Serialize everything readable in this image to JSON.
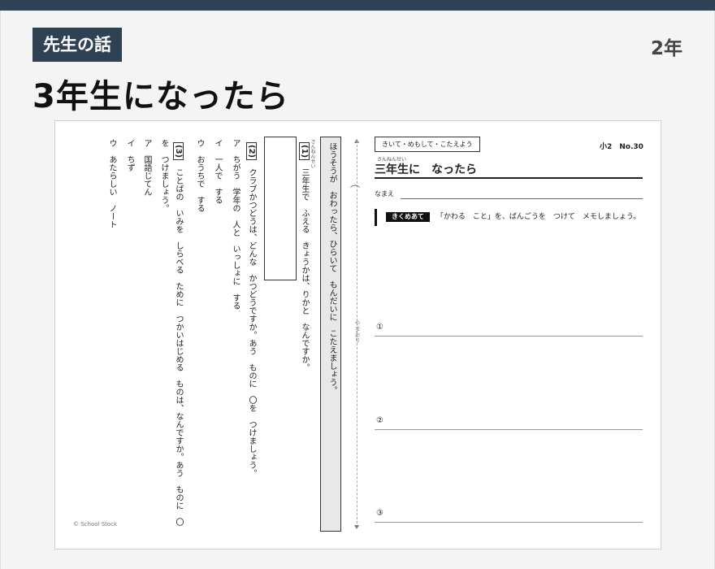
{
  "header": {
    "badge": "先生の話",
    "grade": "2年",
    "title": "3年生になったら"
  },
  "worksheet": {
    "copyright": "© School Stock",
    "fold_label": "やまおり",
    "fold_icon": "⌒",
    "instruction": "ほうそうが　おわったら、ひらいて　もんだいに　こたえましょう。",
    "q1": {
      "number": "(1)",
      "ruby": "さんねんせい",
      "text": "三年生で　ふえる　きょうかは、りかと　なんですか。"
    },
    "q2": {
      "number": "(2)",
      "text": "クラブかつどうは、どんな　かつどうですか。あう　ものに　〇を　つけましょう。",
      "options": [
        {
          "letter": "ア",
          "text": "ちがう　学年の　人と　いっしょに　する"
        },
        {
          "letter": "イ",
          "text": "一人で　する"
        },
        {
          "letter": "ウ",
          "text": "おうちで　する"
        }
      ]
    },
    "q3": {
      "number": "(3)",
      "text": "ことばの　いみを　しらべる　ために　つかいはじめる　ものは、なんですか。あう　ものに　〇",
      "text_cont": "を　つけましょう。",
      "options": [
        {
          "letter": "ア",
          "text": "国語じてん"
        },
        {
          "letter": "イ",
          "text": "ちず"
        },
        {
          "letter": "ウ",
          "text": "あたらしい　ノート"
        }
      ]
    },
    "right": {
      "tag": "きいて・めもして・こたえよう",
      "lesson_no": "小2　No.30",
      "ruby": "さんねんせい",
      "lesson_title": "三年生に　なったら",
      "name_label": "なまえ",
      "task_label": "きくめあて",
      "task_text": "「かわる　こと」を、ばんごうを　つけて　メモしましょう。",
      "memo_labels": [
        "①",
        "②",
        "③"
      ]
    }
  }
}
